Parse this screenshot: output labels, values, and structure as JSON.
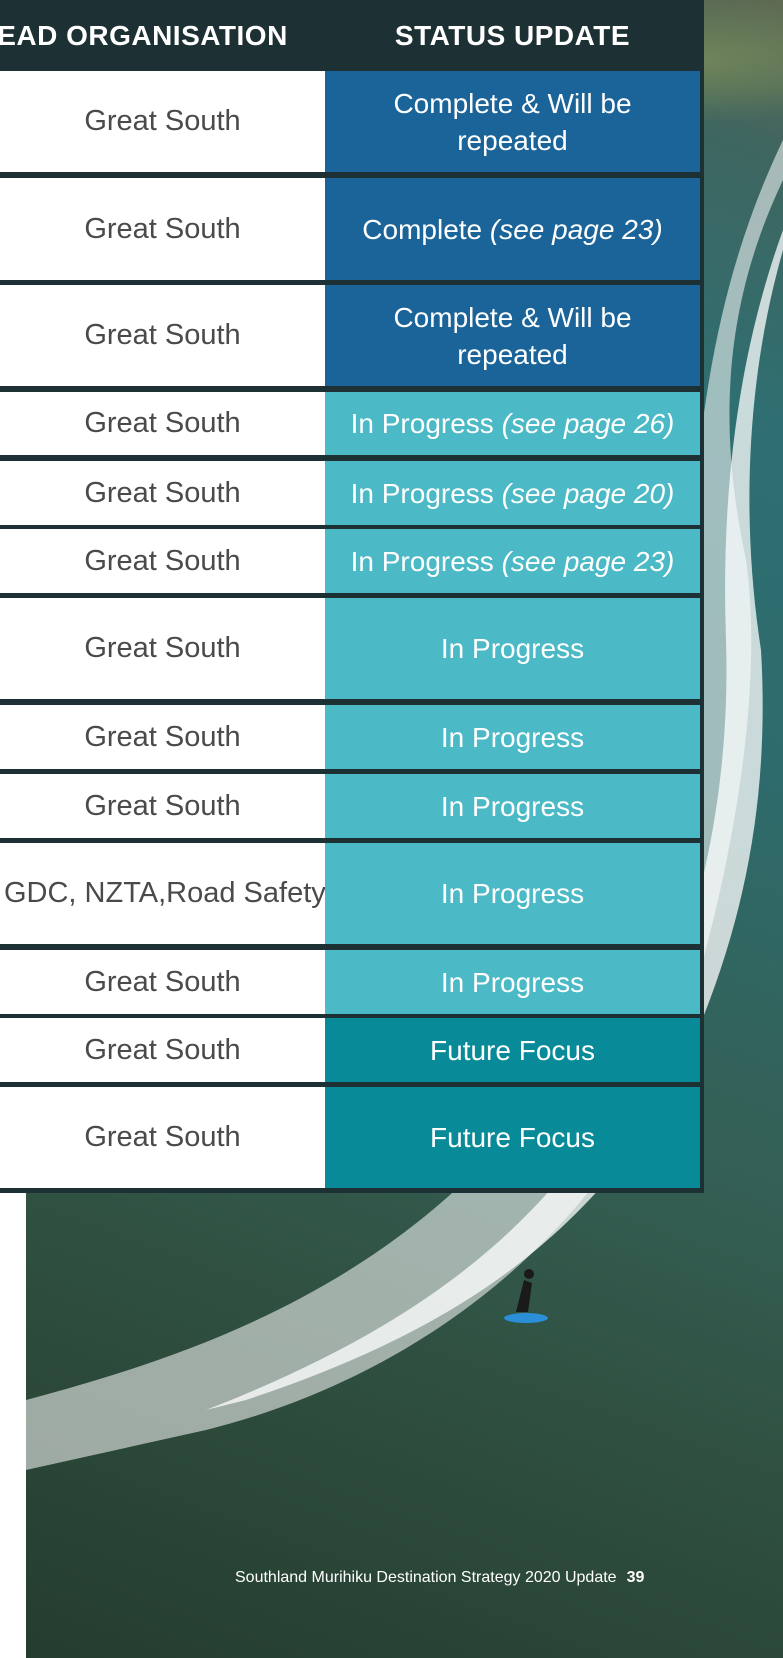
{
  "table": {
    "headers": {
      "lead": "EAD ORGANISATION",
      "status": "STATUS UPDATE"
    },
    "rows": [
      {
        "lead": [
          "Great South"
        ],
        "status": "Complete & Will be repeated",
        "note": "",
        "kind": "complete"
      },
      {
        "lead": [
          "Great South"
        ],
        "status": "Complete ",
        "note": "(see page 23)",
        "kind": "complete"
      },
      {
        "lead": [
          "Great South"
        ],
        "status": "Complete & Will be repeated",
        "note": "",
        "kind": "complete"
      },
      {
        "lead": [
          "Great South"
        ],
        "status": "In Progress ",
        "note": "(see page 26)",
        "kind": "progress"
      },
      {
        "lead": [
          "Great South"
        ],
        "status": "In Progress ",
        "note": "(see page 20)",
        "kind": "progress"
      },
      {
        "lead": [
          "Great South"
        ],
        "status": "In Progress ",
        "note": "(see page 23)",
        "kind": "progress"
      },
      {
        "lead": [
          "Great South"
        ],
        "status": "In Progress",
        "note": "",
        "kind": "progress"
      },
      {
        "lead": [
          "Great South"
        ],
        "status": "In Progress",
        "note": "",
        "kind": "progress"
      },
      {
        "lead": [
          "Great South"
        ],
        "status": "In Progress",
        "note": "",
        "kind": "progress"
      },
      {
        "lead": [
          "ICC, SDC, GDC, NZTA,",
          "Road Safety Southland"
        ],
        "status": "In Progress",
        "note": "",
        "kind": "progress"
      },
      {
        "lead": [
          "Great South"
        ],
        "status": "In Progress",
        "note": "",
        "kind": "progress"
      },
      {
        "lead": [
          "Great South"
        ],
        "status": "Future Focus",
        "note": "",
        "kind": "future"
      },
      {
        "lead": [
          "Great South"
        ],
        "status": "Future Focus",
        "note": "",
        "kind": "future"
      }
    ]
  },
  "footer": {
    "title": "Southland Murihiku Destination Strategy 2020 Update",
    "page": "39"
  },
  "colors": {
    "complete": "#1b6499",
    "progress": "#4bb9c6",
    "future": "#088a98",
    "border": "#1d3033"
  }
}
